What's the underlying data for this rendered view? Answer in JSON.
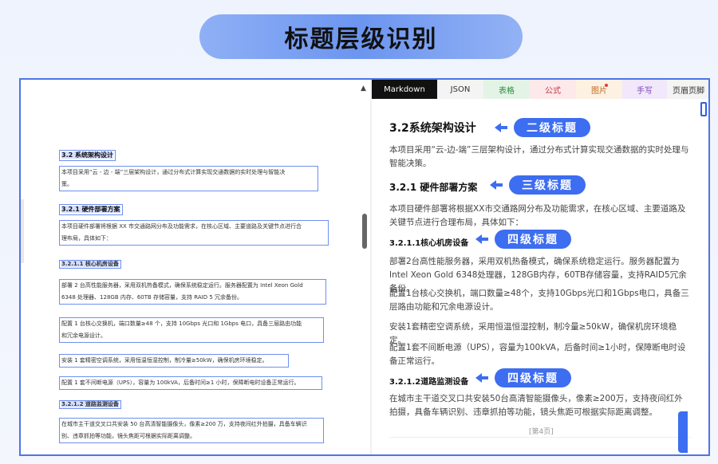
{
  "banner": {
    "title": "标题层级识别"
  },
  "left_doc": {
    "blocks": [
      {
        "kind": "h",
        "text": "3.2 系统架构设计"
      },
      {
        "kind": "p",
        "lines": [
          "本项目采用“云 - 边 - 端”三层架构设计，通过分布式计算实现交通数据的实时处理与智能决",
          "策。"
        ]
      },
      {
        "kind": "h",
        "text": "3.2.1 硬件部署方案"
      },
      {
        "kind": "p",
        "lines": [
          "本项目硬件部署将根据 XX 市交通路网分布及功能需求，在核心区域、主要道路及关键节点进行合",
          "理布局，具体如下："
        ]
      },
      {
        "kind": "h4",
        "text": "3.2.1.1 核心机房设备"
      },
      {
        "kind": "p",
        "lines": [
          "部署 2 台高性能服务器，采用双机热备模式，确保系统稳定运行。服务器配置为 Intel Xeon Gold",
          "6348 处理器、128GB 内存、60TB 存储容量，支持 RAID 5 冗余备份。"
        ]
      },
      {
        "kind": "p",
        "lines": [
          "配置 1 台核心交换机，端口数量≥48 个，支持 10Gbps 光口和 1Gbps 电口，具备三层路由功能",
          "和冗余电源设计。"
        ]
      },
      {
        "kind": "p",
        "lines": [
          "安装 1 套精密空调系统，采用恒温恒湿控制，制冷量≥50kW，确保机房环境稳定。"
        ]
      },
      {
        "kind": "p",
        "lines": [
          "配置 1 套不间断电源（UPS），容量为 100kVA，后备时间≥1 小时，保障断电时设备正常运行。"
        ]
      },
      {
        "kind": "h4",
        "text": "3.2.1.2 道路监测设备"
      },
      {
        "kind": "p",
        "lines": [
          "在城市主干道交叉口共安装 50 台高清智能摄像头，像素≥200 万，支持夜间红外拍摄，具备车辆识",
          "别、违章抓拍等功能，镜头焦距可根据实际距离调整。"
        ]
      }
    ]
  },
  "tabs": [
    "Markdown",
    "JSON",
    "表格",
    "公式",
    "图片",
    "手写",
    "页眉页脚"
  ],
  "right": {
    "h2": "3.2系统架构设计",
    "p1": "本项目采用“云-边-端”三层架构设计，通过分布式计算实现交通数据的实时处理与智能决策。",
    "h3": "3.2.1 硬件部署方案",
    "p2": "本项目硬件部署将根据XX市交通路网分布及功能需求，在核心区域、主要道路及关键节点进行合理布局，具体如下：",
    "h4a": "3.2.1.1核心机房设备",
    "p3": "部署2台高性能服务器，采用双机热备模式，确保系统稳定运行。服务器配置为Intel Xeon Gold 6348处理器，128GB内存，60TB存储容量，支持RAID5冗余备份。",
    "p4": "配置1台核心交换机，端口数量≥48个，支持10Gbps光口和1Gbps电口，具备三层路由功能和冗余电源设计。",
    "p5": "安装1套精密空调系统，采用恒温恒湿控制，制冷量≥50kW，确保机房环境稳定。",
    "p6": "配置1套不间断电源（UPS），容量为100kVA，后备时间≥1小时，保障断电时设备正常运行。",
    "h4b": "3.2.1.2道路监测设备",
    "p7": "在城市主干道交叉口共安装50台高清智能摄像头，像素≥200万，支持夜间红外拍摄，具备车辆识别、违章抓拍等功能，镜头焦距可根据实际距离调整。",
    "page": "[第4页]"
  },
  "labels": {
    "l2": "二级标题",
    "l3": "三级标题",
    "l4a": "四级标题",
    "l4b": "四级标题"
  },
  "colors": {
    "accent": "#3d6df0",
    "frame": "#4f74e6"
  }
}
